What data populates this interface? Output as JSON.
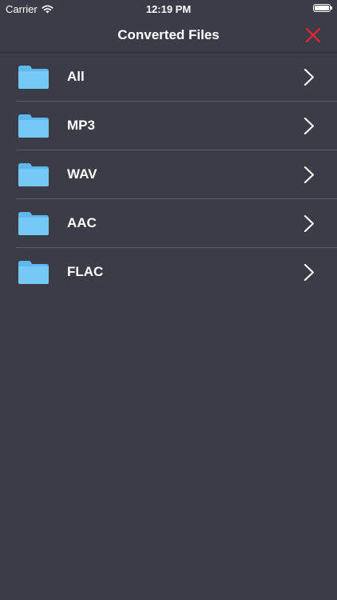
{
  "status_bar": {
    "carrier": "Carrier",
    "time": "12:19 PM",
    "battery_level": 1.0
  },
  "nav": {
    "title": "Converted Files",
    "close_icon": "close-icon",
    "close_color": "#d9282f"
  },
  "folders": [
    {
      "label": "All"
    },
    {
      "label": "MP3"
    },
    {
      "label": "WAV"
    },
    {
      "label": "AAC"
    },
    {
      "label": "FLAC"
    }
  ],
  "colors": {
    "background": "#3b3c47",
    "folder": "#6ec6f5",
    "divider": "#5b5c66"
  }
}
